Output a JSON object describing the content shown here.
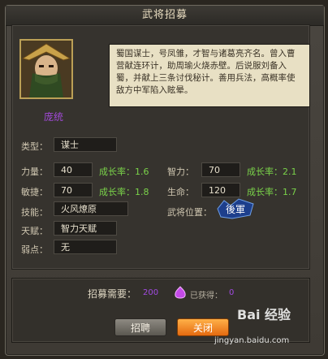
{
  "window": {
    "title": "武将招募"
  },
  "character": {
    "name": "庞统",
    "description": "蜀国谋士，号凤雏，才智与诸葛亮齐名。曾入曹营献连环计，助周瑜火烧赤壁。后说服刘备入蜀，并献上三条讨伐秘计。善用兵法，高概率使敌方中军陷入眩晕。"
  },
  "stats": {
    "type_label": "类型：",
    "type_value": "谋士",
    "strength_label": "力量：",
    "strength_value": "40",
    "strength_growth": "成长率：1.6",
    "intellect_label": "智力：",
    "intellect_value": "70",
    "intellect_growth": "成长率：2.1",
    "agility_label": "敏捷：",
    "agility_value": "70",
    "agility_growth": "成长率：1.8",
    "life_label": "生命：",
    "life_value": "120",
    "life_growth": "成长率：1.7",
    "skill_label": "技能：",
    "skill_value": "火风燎原",
    "position_label": "武将位置：",
    "position_badge": "後軍",
    "talent_label": "天赋：",
    "talent_value": "智力天赋",
    "weakness_label": "弱点：",
    "weakness_value": "无"
  },
  "recruit": {
    "cost_label": "招募需要：",
    "cost_value": "200",
    "owned_label": "已获得：",
    "owned_value": "0",
    "gem_icon": "purple-gem-icon"
  },
  "buttons": {
    "hire": "招聘",
    "close": "关闭"
  },
  "watermark": {
    "brand": "Bai 经验",
    "url": "jingyan.baidu.com"
  }
}
